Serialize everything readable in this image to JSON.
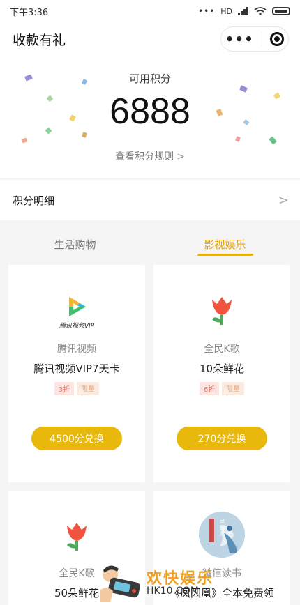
{
  "status_bar": {
    "time": "下午3:36",
    "network": "HD"
  },
  "nav": {
    "title": "收款有礼"
  },
  "points": {
    "label": "可用积分",
    "value": "6888",
    "rules_link": "查看积分规则"
  },
  "detail": {
    "label": "积分明细"
  },
  "tabs": [
    {
      "label": "生活购物",
      "active": false
    },
    {
      "label": "影视娱乐",
      "active": true
    }
  ],
  "products": [
    {
      "brand": "腾讯视频",
      "name": "腾讯视频VIP7天卡",
      "discount": "3折",
      "limit": "限量",
      "button": "4500分兑换",
      "logo_text": "腾讯视频VIP",
      "icon": "tencent-video-icon"
    },
    {
      "brand": "全民K歌",
      "name": "10朵鲜花",
      "discount": "6折",
      "limit": "限量",
      "button": "270分兑换",
      "icon": "tulip-icon"
    },
    {
      "brand": "全民K歌",
      "name": "50朵鲜花",
      "icon": "tulip-icon"
    },
    {
      "brand": "微信读书",
      "name": "《凤囚凰》全本免费领",
      "icon": "book-cover-icon",
      "cover_text": "凤囚凰"
    }
  ],
  "watermark": {
    "text": "欢快娱乐",
    "url": "HK10.COM"
  },
  "colors": {
    "accent": "#e9b80c",
    "tab_active": "#e3a30a",
    "discount_tag_bg": "#fde4e1",
    "limit_tag_bg": "#fbeadf"
  }
}
